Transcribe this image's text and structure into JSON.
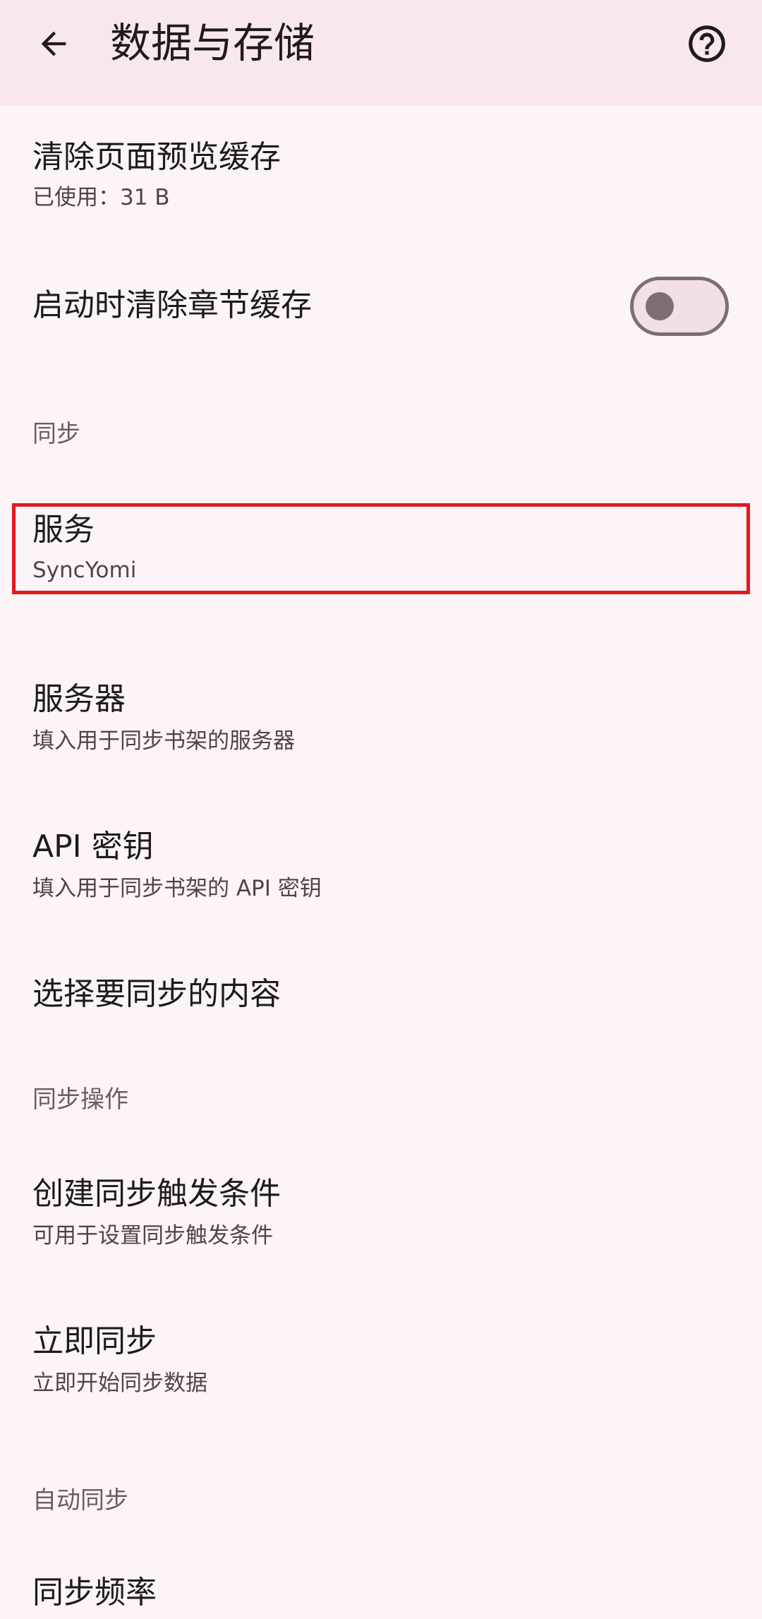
{
  "appbar": {
    "title": "数据与存储",
    "back_icon": "arrow-back-icon",
    "help_icon": "help-circle-icon"
  },
  "items": {
    "clear_preview_cache": {
      "title": "清除页面预览缓存",
      "subtitle": "已使用：31 B"
    },
    "clear_chapter_cache_on_launch": {
      "title": "启动时清除章节缓存",
      "toggle_on": false
    },
    "sync_header": "同步",
    "service": {
      "title": "服务",
      "subtitle": "SyncYomi"
    },
    "server": {
      "title": "服务器",
      "subtitle": "填入用于同步书架的服务器"
    },
    "api_key": {
      "title": "API 密钥",
      "subtitle": "填入用于同步书架的 API 密钥"
    },
    "choose_content": {
      "title": "选择要同步的内容"
    },
    "sync_actions_header": "同步操作",
    "create_triggers": {
      "title": "创建同步触发条件",
      "subtitle": "可用于设置同步触发条件"
    },
    "sync_now": {
      "title": "立即同步",
      "subtitle": "立即开始同步数据"
    },
    "auto_sync_header": "自动同步",
    "sync_frequency": {
      "title": "同步频率"
    }
  },
  "colors": {
    "background": "#fdf4f7",
    "appbar": "#f8e8ed",
    "highlight": "#e3191e",
    "secondary_text": "#4f4449",
    "section_header": "#6a5e63"
  }
}
